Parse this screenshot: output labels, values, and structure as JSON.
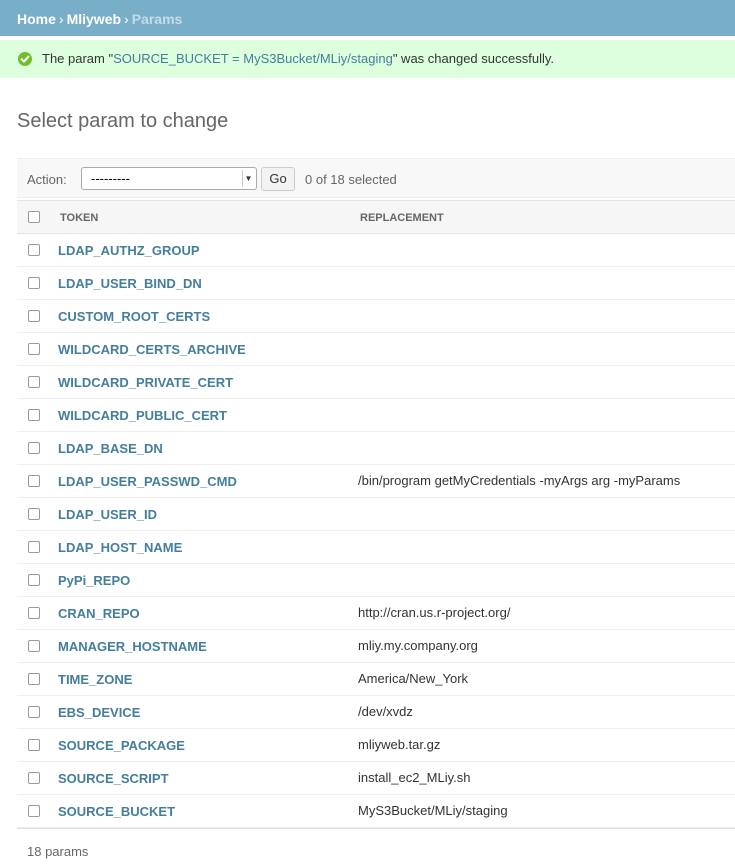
{
  "breadcrumbs": {
    "home": "Home",
    "separator": "›",
    "app": "Mliyweb",
    "current": "Params"
  },
  "message": {
    "prefix": "The param \"",
    "object_link": "SOURCE_BUCKET = MyS3Bucket/MLiy/staging",
    "suffix": "\" was changed successfully.",
    "icon": "success-check-icon"
  },
  "page_title": "Select param to change",
  "actions": {
    "label": "Action:",
    "selected_option": "---------",
    "go_label": "Go",
    "counter": "0 of 18 selected"
  },
  "table": {
    "headers": {
      "token": "TOKEN",
      "replacement": "REPLACEMENT"
    },
    "rows": [
      {
        "token": "LDAP_AUTHZ_GROUP",
        "replacement": ""
      },
      {
        "token": "LDAP_USER_BIND_DN",
        "replacement": ""
      },
      {
        "token": "CUSTOM_ROOT_CERTS",
        "replacement": ""
      },
      {
        "token": "WILDCARD_CERTS_ARCHIVE",
        "replacement": ""
      },
      {
        "token": "WILDCARD_PRIVATE_CERT",
        "replacement": ""
      },
      {
        "token": "WILDCARD_PUBLIC_CERT",
        "replacement": ""
      },
      {
        "token": "LDAP_BASE_DN",
        "replacement": ""
      },
      {
        "token": "LDAP_USER_PASSWD_CMD",
        "replacement": "/bin/program getMyCredentials -myArgs arg -myParams"
      },
      {
        "token": "LDAP_USER_ID",
        "replacement": ""
      },
      {
        "token": "LDAP_HOST_NAME",
        "replacement": ""
      },
      {
        "token": "PyPi_REPO",
        "replacement": ""
      },
      {
        "token": "CRAN_REPO",
        "replacement": "http://cran.us.r-project.org/"
      },
      {
        "token": "MANAGER_HOSTNAME",
        "replacement": "mliy.my.company.org"
      },
      {
        "token": "TIME_ZONE",
        "replacement": "America/New_York"
      },
      {
        "token": "EBS_DEVICE",
        "replacement": "/dev/xvdz"
      },
      {
        "token": "SOURCE_PACKAGE",
        "replacement": "mliyweb.tar.gz"
      },
      {
        "token": "SOURCE_SCRIPT",
        "replacement": "install_ec2_MLiy.sh"
      },
      {
        "token": "SOURCE_BUCKET",
        "replacement": "MyS3Bucket/MLiy/staging"
      }
    ]
  },
  "paginator": "18 params",
  "colors": {
    "header_bg": "#79aec8",
    "link": "#447e9b",
    "success_bg": "#ddffdd",
    "success_icon": "#70bf2b"
  }
}
